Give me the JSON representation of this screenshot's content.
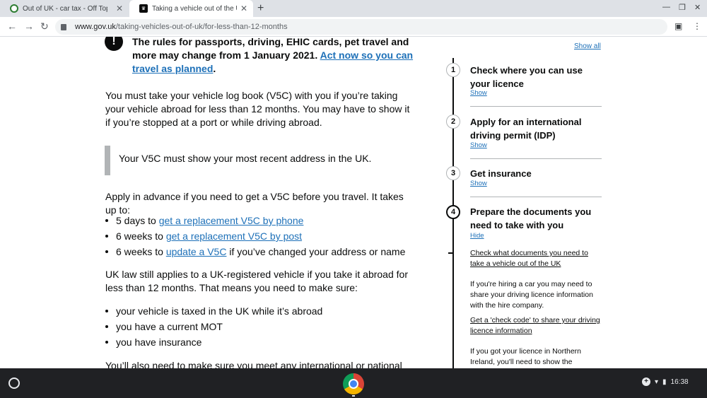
{
  "browser": {
    "tabs": [
      {
        "title": "Out of UK - car tax - Off Topic Ch",
        "favicon": "forum-favicon-icon"
      },
      {
        "title": "Taking a vehicle out of the UK: F",
        "favicon": "gov-uk-favicon-icon"
      }
    ],
    "new_tab": "+",
    "url_host": "www.gov.uk",
    "url_path": "/taking-vehicles-out-of-uk/for-less-than-12-months"
  },
  "alert": {
    "icon": "!",
    "text": "The rules for passports, driving, EHIC cards, pet travel and more may change from 1 January 2021. ",
    "link": "Act now so you can travel as planned",
    "end": "."
  },
  "body": {
    "p1": "You must take your vehicle log book (V5C) with you if you’re taking your vehicle abroad for less than 12 months. You may have to show it if you’re stopped at a port or while driving abroad.",
    "inset": "Your V5C must show your most recent address in the UK.",
    "p2": "Apply in advance if you need to get a V5C before you travel. It takes up to:",
    "list1": [
      {
        "pre": "5 days to ",
        "link": "get a replacement V5C by phone",
        "post": ""
      },
      {
        "pre": "6 weeks to ",
        "link": "get a replacement V5C by post",
        "post": ""
      },
      {
        "pre": "6 weeks to ",
        "link": "update a V5C",
        "post": " if you’ve changed your address or name"
      }
    ],
    "p3": "UK law still applies to a UK-registered vehicle if you take it abroad for less than 12 months. That means you need to make sure:",
    "list2": [
      "your vehicle is taxed in the UK while it’s abroad",
      "you have a current MOT",
      "you have insurance"
    ],
    "p4": "You’ll also need to make sure you meet any international or national"
  },
  "stepnav": {
    "show_all": "Show all",
    "steps": [
      {
        "num": "1",
        "title": "Check where you can use your licence",
        "toggle": "Show"
      },
      {
        "num": "2",
        "title": "Apply for an international driving permit (IDP)",
        "toggle": "Show"
      },
      {
        "num": "3",
        "title": "Get insurance",
        "toggle": "Show"
      },
      {
        "num": "4",
        "title": "Prepare the documents you need to take with you",
        "toggle": "Hide"
      }
    ],
    "sub_link": "Check what documents you need to take a vehicle out of the UK",
    "sub_p1": "If you're hiring a car you may need to share your driving licence information with the hire company.",
    "sub_link2": "Get a 'check code' to share your driving licence information",
    "sub_p2": "If you got your licence in Northern Ireland, you'll need to show the"
  },
  "taskbar": {
    "time": "16:38"
  }
}
